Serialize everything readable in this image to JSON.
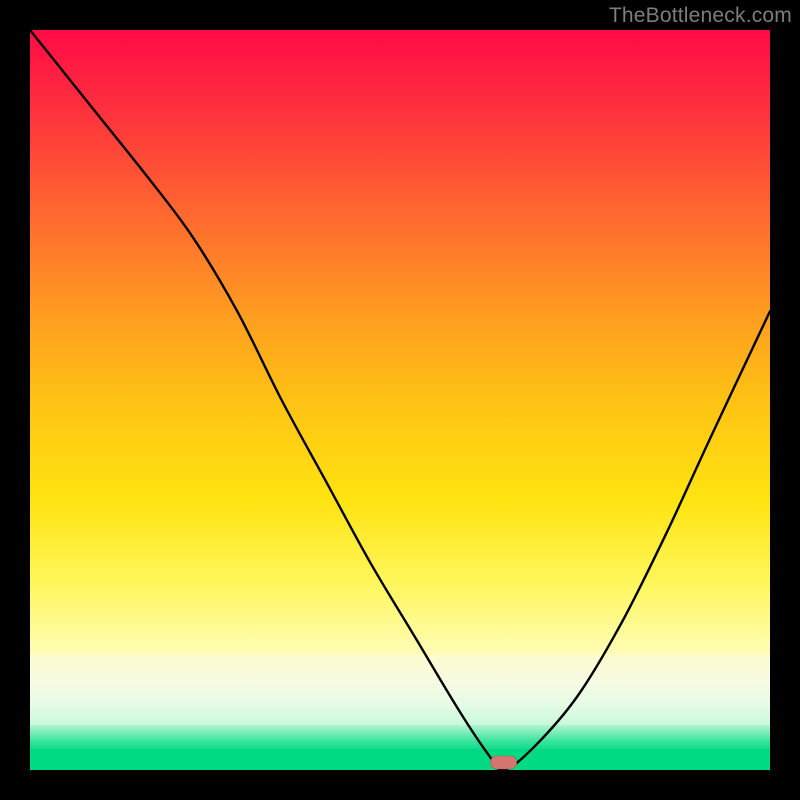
{
  "watermark": "TheBottleneck.com",
  "marker": {
    "x_pct": 64,
    "label": "optimal-point"
  },
  "colors": {
    "top": "#ff0b46",
    "mid_orange": "#ff9b20",
    "yellow": "#ffe310",
    "pale": "#fdfccf",
    "green": "#00db83",
    "curve": "#000000",
    "marker": "#d4766f",
    "frame": "#000000"
  },
  "chart_data": {
    "type": "line",
    "title": "",
    "xlabel": "",
    "ylabel": "",
    "xlim": [
      0,
      100
    ],
    "ylim": [
      0,
      100
    ],
    "series": [
      {
        "name": "bottleneck-curve",
        "x": [
          0,
          8,
          16,
          22,
          28,
          34,
          40,
          46,
          52,
          58,
          62,
          64,
          68,
          74,
          80,
          86,
          92,
          100
        ],
        "y": [
          100,
          90,
          80,
          72,
          62,
          50,
          39,
          28,
          18,
          8,
          2,
          0,
          3,
          10,
          20,
          32,
          45,
          62
        ]
      }
    ],
    "annotations": [
      {
        "type": "marker",
        "x": 64,
        "y": 0,
        "shape": "pill"
      }
    ]
  }
}
